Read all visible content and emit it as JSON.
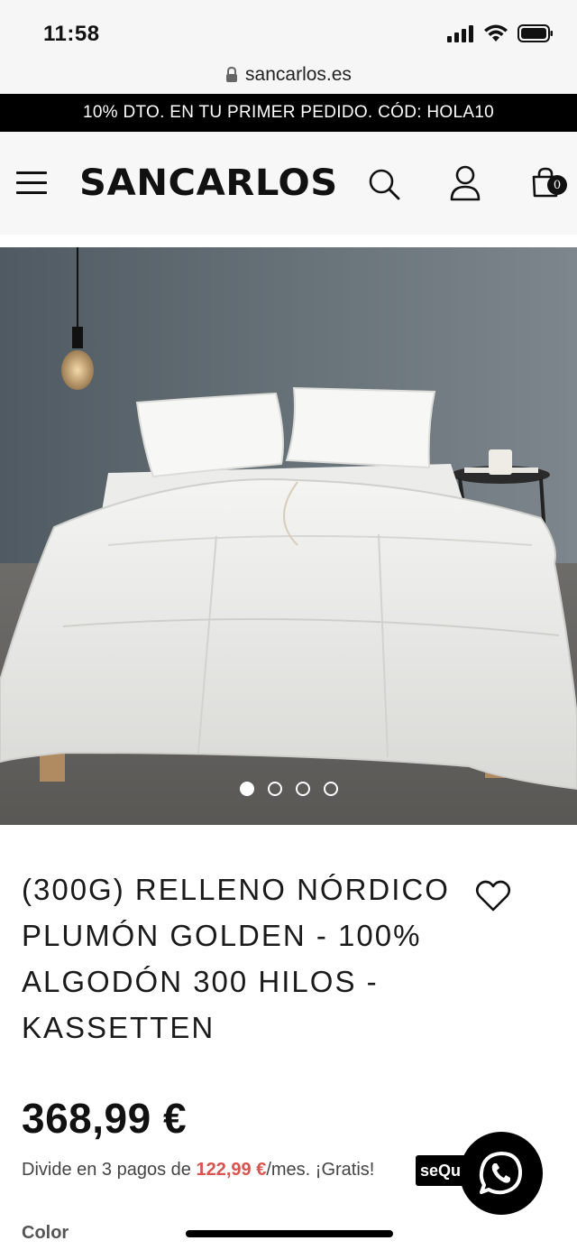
{
  "status_bar": {
    "time": "11:58"
  },
  "browser": {
    "url": "sancarlos.es"
  },
  "promo": {
    "text": "10% DTO. EN TU PRIMER PEDIDO. CÓD: HOLA10"
  },
  "header": {
    "logo": "SANCARLOS",
    "cart_count": "0"
  },
  "gallery": {
    "image_count": 4,
    "active_index": 0
  },
  "product": {
    "title": "(300G) RELLENO NÓRDICO PLUMÓN GOLDEN - 100% ALGODÓN 300 HILOS - KASSETTEN",
    "price": "368,99 €",
    "installments_prefix": "Divide en 3 pagos de ",
    "installments_amount": "122,99 €",
    "installments_suffix": "/mes. ¡Gratis!",
    "financing_badge": "seQura",
    "color_label": "Color"
  },
  "colors": {
    "accent_red": "#d9534f",
    "promo_bg": "#000000",
    "header_bg": "#f7f7f7"
  },
  "icons": [
    "lock-icon",
    "menu-icon",
    "search-icon",
    "user-icon",
    "cart-icon",
    "heart-icon",
    "whatsapp-icon",
    "signal-icon",
    "wifi-icon",
    "battery-icon"
  ]
}
